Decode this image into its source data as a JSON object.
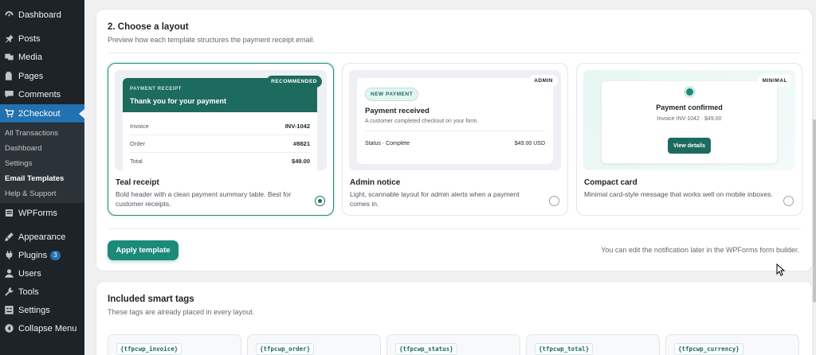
{
  "sidebar": {
    "items": [
      {
        "label": "Dashboard",
        "icon": "dashboard-icon"
      },
      {
        "label": "Posts",
        "icon": "pin-icon"
      },
      {
        "label": "Media",
        "icon": "media-icon"
      },
      {
        "label": "Pages",
        "icon": "pages-icon"
      },
      {
        "label": "Comments",
        "icon": "comment-icon"
      },
      {
        "label": "2Checkout",
        "icon": "cart-icon"
      }
    ],
    "submenu": [
      "All Transactions",
      "Dashboard",
      "Settings",
      "Email Templates",
      "Help & Support"
    ],
    "items2": [
      {
        "label": "WPForms",
        "icon": "form-icon"
      },
      {
        "label": "Appearance",
        "icon": "brush-icon"
      },
      {
        "label": "Plugins",
        "icon": "plugin-icon",
        "badge": "3"
      },
      {
        "label": "Users",
        "icon": "user-icon"
      },
      {
        "label": "Tools",
        "icon": "wrench-icon"
      },
      {
        "label": "Settings",
        "icon": "settings-icon"
      },
      {
        "label": "Collapse Menu",
        "icon": "collapse-icon"
      }
    ]
  },
  "layout": {
    "title": "2. Choose a layout",
    "subtitle": "Preview how each template structures the payment receipt email.",
    "options": [
      {
        "title": "Teal receipt",
        "desc": "Bold header with a clean payment summary table. Best for customer receipts.",
        "badge": "RECOMMENDED",
        "kicker": "PAYMENT RECEIPT",
        "heading": "Thank you for your payment",
        "rows": [
          {
            "k": "Invoice",
            "v": "INV-1042"
          },
          {
            "k": "Order",
            "v": "#8821"
          },
          {
            "k": "Total",
            "v": "$49.00"
          }
        ]
      },
      {
        "title": "Admin notice",
        "desc": "Light, scannable layout for admin alerts when a payment comes in.",
        "badge": "ADMIN",
        "tag": "NEW PAYMENT",
        "heading": "Payment received",
        "line": "A customer completed checkout on your form.",
        "status_k": "Status · Complete",
        "status_v": "$49.00 USD"
      },
      {
        "title": "Compact card",
        "desc": "Minimal card-style message that works well on mobile inboxes.",
        "badge": "MINIMAL",
        "heading": "Payment confirmed",
        "line": "Invoice INV-1042 · $49.00",
        "button": "View details"
      }
    ],
    "apply": "Apply template",
    "hint": "You can edit the notification later in the WPForms form builder."
  },
  "tags": {
    "title": "Included smart tags",
    "subtitle": "These tags are already placed in every layout.",
    "items": [
      "{tfpcwp_invoice}",
      "{tfpcwp_order}",
      "{tfpcwp_status}",
      "{tfpcwp_total}",
      "{tfpcwp_currency}"
    ]
  },
  "colors": {
    "accent": "#1c8a7a",
    "header": "#1d6b5e",
    "wp_blue": "#2271b1"
  }
}
